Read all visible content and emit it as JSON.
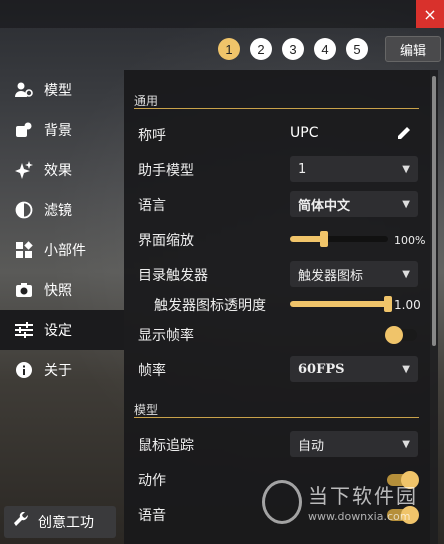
{
  "window": {
    "close_icon": "×"
  },
  "pages": [
    "1",
    "2",
    "3",
    "4",
    "5"
  ],
  "active_page": "1",
  "edit_label": "编辑",
  "sidebar": {
    "items": [
      {
        "label": "模型",
        "icon": "person-gear-icon"
      },
      {
        "label": "背景",
        "icon": "image-icon"
      },
      {
        "label": "效果",
        "icon": "sparkle-icon"
      },
      {
        "label": "滤镜",
        "icon": "contrast-icon"
      },
      {
        "label": "小部件",
        "icon": "widgets-icon"
      },
      {
        "label": "快照",
        "icon": "camera-icon"
      },
      {
        "label": "设定",
        "icon": "sliders-icon"
      },
      {
        "label": "关于",
        "icon": "info-icon"
      }
    ],
    "active_index": 6
  },
  "creative_workshop": "创意工功",
  "settings": {
    "section_general": "通用",
    "nickname_label": "称呼",
    "nickname_value": "UPC",
    "assistant_model_label": "助手模型",
    "assistant_model_value": "1",
    "language_label": "语言",
    "language_value": "简体中文",
    "ui_scale_label": "界面缩放",
    "ui_scale_value": "100%",
    "ui_scale_level": 0.35,
    "directory_trigger_label": "目录触发器",
    "directory_trigger_value": "触发器图标",
    "trigger_opacity_label": "触发器图标透明度",
    "trigger_opacity_value": "1.00",
    "trigger_opacity_level": 1.0,
    "show_fps_label": "显示帧率",
    "show_fps_on": false,
    "fps_label": "帧率",
    "fps_value": "60FPS",
    "section_model": "模型",
    "mouse_tracking_label": "鼠标追踪",
    "mouse_tracking_value": "自动",
    "motion_label": "动作",
    "motion_on": true,
    "voice_label": "语音",
    "voice_on": true
  },
  "watermark": {
    "name": "当下软件园",
    "url": "www.downxia.com"
  },
  "colors": {
    "accent": "#f0c46a",
    "close": "#d9312c"
  }
}
